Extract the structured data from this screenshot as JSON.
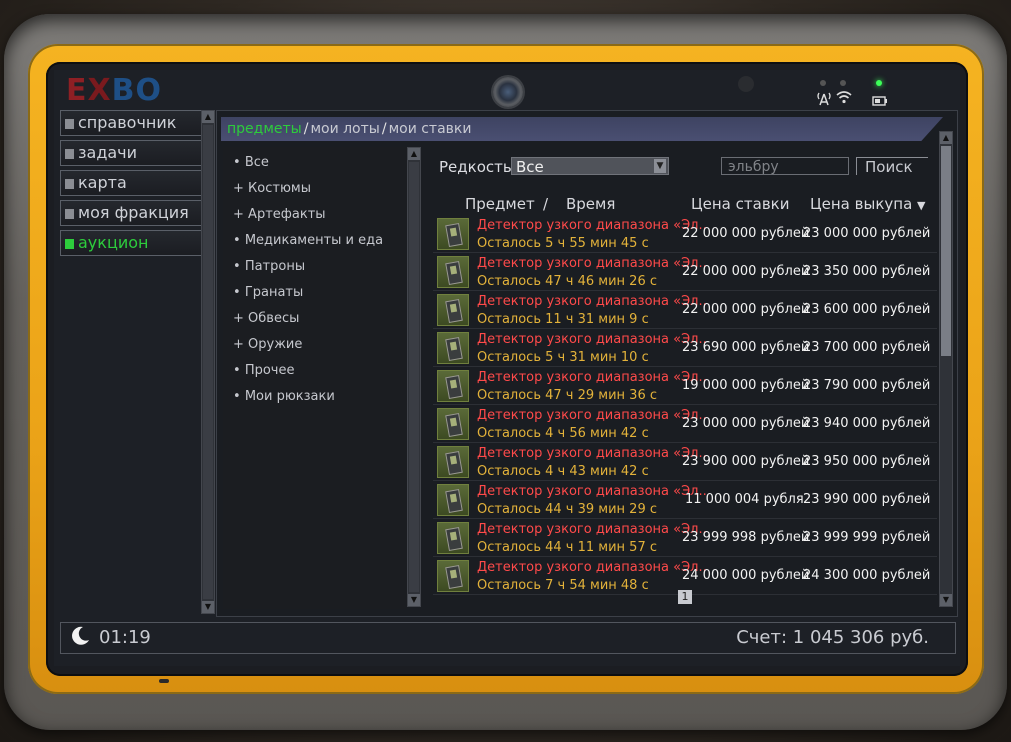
{
  "logo": {
    "part1": "E",
    "part2": "X",
    "part3": "BO"
  },
  "sidebar": {
    "items": [
      {
        "label": "справочник",
        "active": false
      },
      {
        "label": "задачи",
        "active": false
      },
      {
        "label": "карта",
        "active": false
      },
      {
        "label": "моя фракция",
        "active": false
      },
      {
        "label": "аукцион",
        "active": true
      }
    ]
  },
  "tabs": [
    {
      "label": "предметы",
      "active": true
    },
    {
      "label": "мои лоты",
      "active": false
    },
    {
      "label": "мои ставки",
      "active": false
    }
  ],
  "tab_separator": "/",
  "categories": [
    {
      "prefix": "•",
      "label": "Все"
    },
    {
      "prefix": "+",
      "label": "Костюмы"
    },
    {
      "prefix": "+",
      "label": "Артефакты"
    },
    {
      "prefix": "•",
      "label": "Медикаменты и еда"
    },
    {
      "prefix": "•",
      "label": "Патроны"
    },
    {
      "prefix": "•",
      "label": "Гранаты"
    },
    {
      "prefix": "+",
      "label": "Обвесы"
    },
    {
      "prefix": "+",
      "label": "Оружие"
    },
    {
      "prefix": "•",
      "label": "Прочее"
    },
    {
      "prefix": "•",
      "label": "Мои рюкзаки"
    }
  ],
  "filter": {
    "rarity_label": "Редкость",
    "rarity_value": "Все",
    "search_placeholder": "эльбру",
    "search_button": "Поиск"
  },
  "table_headers": {
    "item": "Предмет",
    "separator": "/",
    "time": "Время",
    "bid": "Цена ставки",
    "buyout": "Цена выкупа",
    "sort_indicator": "▼"
  },
  "lots": [
    {
      "name": "Детектор узкого диапазона «Эл..",
      "time": "Осталось 5 ч 55 мин 45 с",
      "bid": "22 000 000 рублей",
      "buyout": "23 000 000 рублей"
    },
    {
      "name": "Детектор узкого диапазона «Эл..",
      "time": "Осталось 47 ч 46 мин 26 с",
      "bid": "22 000 000 рублей",
      "buyout": "23 350 000 рублей"
    },
    {
      "name": "Детектор узкого диапазона «Эл..",
      "time": "Осталось 11 ч 31 мин 9 с",
      "bid": "22 000 000 рублей",
      "buyout": "23 600 000 рублей"
    },
    {
      "name": "Детектор узкого диапазона «Эл..",
      "time": "Осталось 5 ч 31 мин 10 с",
      "bid": "23 690 000 рублей",
      "buyout": "23 700 000 рублей"
    },
    {
      "name": "Детектор узкого диапазона «Эл..",
      "time": "Осталось 47 ч 29 мин 36 с",
      "bid": "19 000 000 рублей",
      "buyout": "23 790 000 рублей"
    },
    {
      "name": "Детектор узкого диапазона «Эл..",
      "time": "Осталось 4 ч 56 мин 42 с",
      "bid": "23 000 000 рублей",
      "buyout": "23 940 000 рублей"
    },
    {
      "name": "Детектор узкого диапазона «Эл..",
      "time": "Осталось 4 ч 43 мин 42 с",
      "bid": "23 900 000 рублей",
      "buyout": "23 950 000 рублей"
    },
    {
      "name": "Детектор узкого диапазона «Эл..",
      "time": "Осталось 44 ч 39 мин 29 с",
      "bid": "11 000 004 рубля",
      "buyout": "23 990 000 рублей"
    },
    {
      "name": "Детектор узкого диапазона «Эл..",
      "time": "Осталось 44 ч 11 мин 57 с",
      "bid": "23 999 998 рублей",
      "buyout": "23 999 999 рублей"
    },
    {
      "name": "Детектор узкого диапазона «Эл..",
      "time": "Осталось 7 ч 54 мин 48 с",
      "bid": "24 000 000 рублей",
      "buyout": "24 300 000 рублей"
    }
  ],
  "pagination": {
    "current_page": "1"
  },
  "status": {
    "time": "01:19",
    "account": "Счет: 1 045 306 руб."
  },
  "colors": {
    "active_green": "#2dcc3c",
    "lot_name_red": "#ff4a4a",
    "time_yellow": "#e3b23a",
    "tablet_yellow": "#f5b321"
  },
  "icons": {
    "moon": "moon-icon",
    "signal": "signal-icon",
    "wifi": "wifi-icon",
    "battery": "battery-icon",
    "item_thumb": "detector-icon"
  }
}
